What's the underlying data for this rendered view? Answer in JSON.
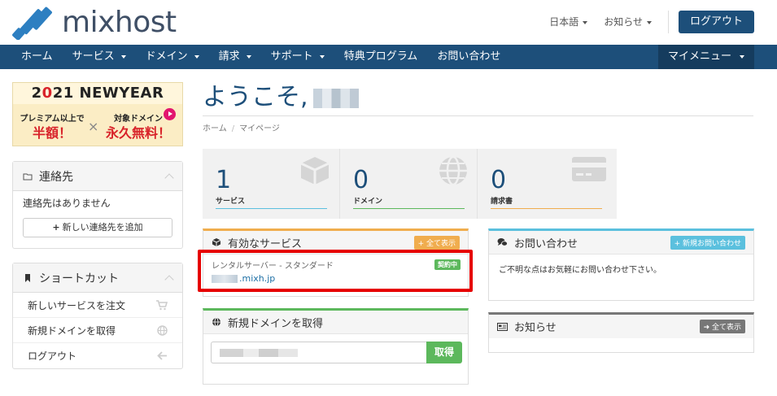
{
  "brand": {
    "name": "mixhost"
  },
  "top_links": {
    "language": "日本語",
    "notices": "お知らせ",
    "logout": "ログアウト"
  },
  "nav": {
    "items": [
      {
        "label": "ホーム"
      },
      {
        "label": "サービス"
      },
      {
        "label": "ドメイン"
      },
      {
        "label": "請求"
      },
      {
        "label": "サポート"
      },
      {
        "label": "特典プログラム"
      },
      {
        "label": "お問い合わせ"
      }
    ],
    "my_menu": "マイメニュー"
  },
  "banner": {
    "year_prefix": "2",
    "year_mid": "0",
    "year_suffix": "21",
    "headline": " NEWYEAR",
    "left_small": "プレミアム以上で",
    "left_big": "半額！",
    "x": "×",
    "right_small": "対象ドメイン",
    "right_big": "永久無料！"
  },
  "contacts": {
    "title": "連絡先",
    "empty": "連絡先はありません",
    "add_button": "新しい連絡先を追加"
  },
  "shortcuts": {
    "title": "ショートカット",
    "items": [
      {
        "label": "新しいサービスを注文"
      },
      {
        "label": "新規ドメインを取得"
      },
      {
        "label": "ログアウト"
      }
    ]
  },
  "main": {
    "welcome": "ようこそ,",
    "breadcrumb": [
      "ホーム",
      "マイページ"
    ]
  },
  "stats": [
    {
      "value": "1",
      "label": "サービス",
      "color": "#5bc0de"
    },
    {
      "value": "0",
      "label": "ドメイン",
      "color": "#5cb85c"
    },
    {
      "value": "0",
      "label": "請求書",
      "color": "#f0ad4e"
    }
  ],
  "active_services": {
    "title": "有効なサービス",
    "view_all": "全て表示",
    "service_name": "レンタルサーバー - スタンダード",
    "domain_suffix": ".mixh.jp",
    "status": "契約中"
  },
  "domain_search": {
    "title": "新規ドメインを取得",
    "button": "取得"
  },
  "inquiry": {
    "title": "お問い合わせ",
    "new_button": "新規お問い合わせ",
    "text": "ご不明な点はお気軽にお問い合わせ下さい。"
  },
  "news": {
    "title": "お知らせ",
    "view_all": "全て表示"
  },
  "colors": {
    "primary": "#1d4f7a",
    "warning": "#f0ad4e",
    "success": "#5cb85c",
    "info": "#5bc0de",
    "muted": "#777777",
    "highlight": "#e60000"
  }
}
